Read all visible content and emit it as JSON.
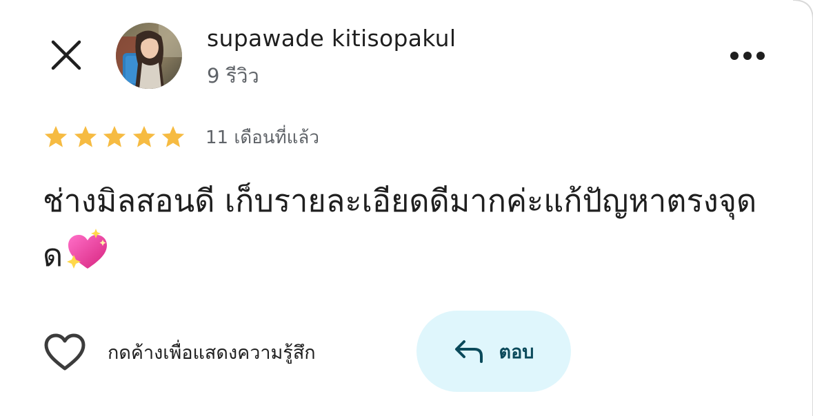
{
  "header": {
    "close_icon": "close-icon",
    "author_name": "supawade kitisopakul",
    "review_count": "9 รีวิว",
    "more_icon": "more-horizontal-icon"
  },
  "review": {
    "rating": 5,
    "rating_max": 5,
    "date": "11 เดือนที่แล้ว",
    "text": "ช่างมิลสอนดี เก็บรายละเอียดดีมากค่ะแก้ปัญหาตรงจุดด",
    "emoji": "sparkling-heart-emoji"
  },
  "actions": {
    "like_label": "กดค้างเพื่อแสดงความรู้สึก",
    "like_icon": "heart-outline-icon",
    "reply_label": "ตอบ",
    "reply_icon": "reply-arrow-icon"
  },
  "colors": {
    "star": "#f6bb42",
    "reply_bg": "#dff6fc",
    "reply_text": "#0b4a5b",
    "secondary_text": "#5f6368"
  }
}
